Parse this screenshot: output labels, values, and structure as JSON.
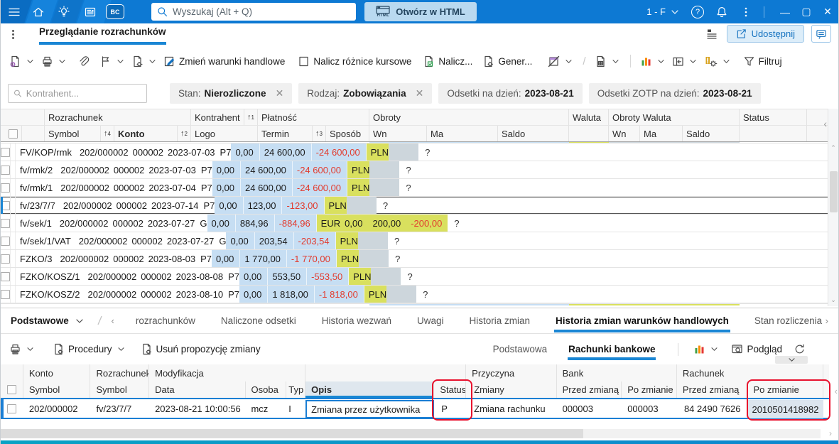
{
  "titlebar": {
    "search_placeholder": "Wyszukaj (Alt + Q)",
    "bc_badge": "BC",
    "open_html": "Otwórz w HTML",
    "html_icon_text": "HTML",
    "profile_label": "1 - F"
  },
  "tabstrip": {
    "tab": "Przeglądanie rozrachunków",
    "share": "Udostępnij"
  },
  "toolbar": {
    "zmien_warunki_handlowe": "Zmień warunki handlowe",
    "nalicz_roznice_kursowe": "Nalicz różnice kursowe",
    "nalicz": "Nalicz...",
    "generuj": "Gener...",
    "filtruj": "Filtruj"
  },
  "filterbar": {
    "kontrahent_placeholder": "Kontrahent...",
    "chips": [
      {
        "label": "Stan:",
        "value": "Nierozliczone",
        "closable": true
      },
      {
        "label": "Rodzaj:",
        "value": "Zobowiązania",
        "closable": true
      },
      {
        "label": "Odsetki  na dzień:",
        "value": "2023-08-21",
        "closable": false
      },
      {
        "label": "Odsetki ZOTP  na dzień:",
        "value": "2023-08-21",
        "closable": false
      }
    ]
  },
  "grid": {
    "group_headers": {
      "rozrachunek": "Rozrachunek",
      "kontrahent": "Kontrahent",
      "platnosc": "Płatność",
      "obroty": "Obroty",
      "waluta": "Waluta",
      "obroty_waluta": "Obroty Waluta",
      "status": "Status"
    },
    "sub_headers": {
      "symbol": "Symbol",
      "konto": "Konto",
      "logo": "Logo",
      "termin": "Termin",
      "sposob": "Sposób",
      "wn": "Wn",
      "ma": "Ma",
      "saldo": "Saldo",
      "wwn": "Wn",
      "wma": "Ma",
      "wsaldo": "Saldo"
    },
    "sort_order": {
      "kontrahent": "1",
      "konto": "2",
      "termin": "3",
      "symbol": "4"
    },
    "col_order": [
      "symbol",
      "konto",
      "logo",
      "termin",
      "sposob",
      "wn",
      "ma",
      "saldo",
      "waluta",
      "wwn",
      "wma",
      "wsaldo",
      "status"
    ],
    "rows": [
      {
        "symbol": "FV/KOP/rmk",
        "konto": "202/000002",
        "logo": "000002",
        "termin": "2023-07-03",
        "sposob": "P7",
        "wn": "0,00",
        "ma": "24 600,00",
        "saldo": "-24 600,00",
        "waluta": "PLN",
        "wwn": "",
        "wma": "",
        "wsaldo": "",
        "status": "?",
        "selected": false
      },
      {
        "symbol": "fv/rmk/2",
        "konto": "202/000002",
        "logo": "000002",
        "termin": "2023-07-03",
        "sposob": "P7",
        "wn": "0,00",
        "ma": "24 600,00",
        "saldo": "-24 600,00",
        "waluta": "PLN",
        "wwn": "",
        "wma": "",
        "wsaldo": "",
        "status": "?",
        "selected": false
      },
      {
        "symbol": "fv/rmk/1",
        "konto": "202/000002",
        "logo": "000002",
        "termin": "2023-07-04",
        "sposob": "P7",
        "wn": "0,00",
        "ma": "24 600,00",
        "saldo": "-24 600,00",
        "waluta": "PLN",
        "wwn": "",
        "wma": "",
        "wsaldo": "",
        "status": "?",
        "selected": false
      },
      {
        "symbol": "fv/23/7/7",
        "konto": "202/000002",
        "logo": "000002",
        "termin": "2023-07-14",
        "sposob": "P7",
        "wn": "0,00",
        "ma": "123,00",
        "saldo": "-123,00",
        "waluta": "PLN",
        "wwn": "",
        "wma": "",
        "wsaldo": "",
        "status": "?",
        "selected": true
      },
      {
        "symbol": "fv/sek/1",
        "konto": "202/000002",
        "logo": "000002",
        "termin": "2023-07-27",
        "sposob": "G",
        "wn": "0,00",
        "ma": "884,96",
        "saldo": "-884,96",
        "waluta": "EUR",
        "wwn": "0,00",
        "wma": "200,00",
        "wsaldo": "-200,00",
        "status": "?",
        "selected": false
      },
      {
        "symbol": "fv/sek/1/VAT",
        "konto": "202/000002",
        "logo": "000002",
        "termin": "2023-07-27",
        "sposob": "G",
        "wn": "0,00",
        "ma": "203,54",
        "saldo": "-203,54",
        "waluta": "PLN",
        "wwn": "",
        "wma": "",
        "wsaldo": "",
        "status": "?",
        "selected": false
      },
      {
        "symbol": "FZKO/3",
        "konto": "202/000002",
        "logo": "000002",
        "termin": "2023-08-03",
        "sposob": "P7",
        "wn": "0,00",
        "ma": "1 770,00",
        "saldo": "-1 770,00",
        "waluta": "PLN",
        "wwn": "",
        "wma": "",
        "wsaldo": "",
        "status": "?",
        "selected": false
      },
      {
        "symbol": "FZKO/KOSZ/1",
        "konto": "202/000002",
        "logo": "000002",
        "termin": "2023-08-08",
        "sposob": "P7",
        "wn": "0,00",
        "ma": "553,50",
        "saldo": "-553,50",
        "waluta": "PLN",
        "wwn": "",
        "wma": "",
        "wsaldo": "",
        "status": "?",
        "selected": false
      },
      {
        "symbol": "FZKO/KOSZ/2",
        "konto": "202/000002",
        "logo": "000002",
        "termin": "2023-08-10",
        "sposob": "P7",
        "wn": "0,00",
        "ma": "1 818,00",
        "saldo": "-1 818,00",
        "waluta": "PLN",
        "wwn": "",
        "wma": "",
        "wsaldo": "",
        "status": "?",
        "selected": false
      }
    ]
  },
  "bottom_tabs": {
    "group_selector": "Podstawowe",
    "tabs": [
      "rozrachunków",
      "Naliczone odsetki",
      "Historia wezwań",
      "Uwagi",
      "Historia zmian",
      "Historia zmian warunków handlowych",
      "Stan rozliczenia"
    ],
    "active_tab": "Historia zmian warunków handlowych"
  },
  "bottom_toolbar": {
    "procedury": "Procedury",
    "usun_propozycje": "Usuń propozycję zmiany",
    "view_tabs": [
      "Podstawowa",
      "Rachunki bankowe"
    ],
    "active_view": "Rachunki bankowe",
    "podglad": "Podgląd"
  },
  "history_grid": {
    "group_headers": {
      "konto": "Konto",
      "rozrachunek": "Rozrachunek",
      "modyfikacja": "Modyfikacja",
      "przyczyna": "Przyczyna",
      "bank": "Bank",
      "rachunek": "Rachunek"
    },
    "sub_headers": {
      "konto_symbol": "Symbol",
      "roz_symbol": "Symbol",
      "data": "Data",
      "osoba": "Osoba",
      "typ": "Typ",
      "opis": "Opis",
      "status": "Status",
      "zmiany": "Zmiany",
      "bank_przed": "Przed zmianą",
      "bank_po": "Po zmianie",
      "rach_przed": "Przed zmianą",
      "rach_po": "Po zmianie"
    },
    "row": {
      "konto_symbol": "202/000002",
      "roz_symbol": "fv/23/7/7",
      "data": "2023-08-21 10:00:56",
      "osoba": "mcz",
      "typ": "I",
      "opis": "Zmiana przez użytkownika",
      "status": "P",
      "zmiany": "Zmiana rachunku",
      "bank_przed": "000003",
      "bank_po": "000003",
      "rach_przed": "84 2490 7626",
      "rach_po": "2010501418982"
    }
  },
  "colors": {
    "accent": "#1a86d4",
    "titlebar": "#0d79d3",
    "negative": "#e23b2e",
    "annotation_red": "#e8112d",
    "cell_blue": "#c6def3",
    "cell_yellow": "#d9e05e",
    "cell_gray": "#cdd6dc"
  }
}
